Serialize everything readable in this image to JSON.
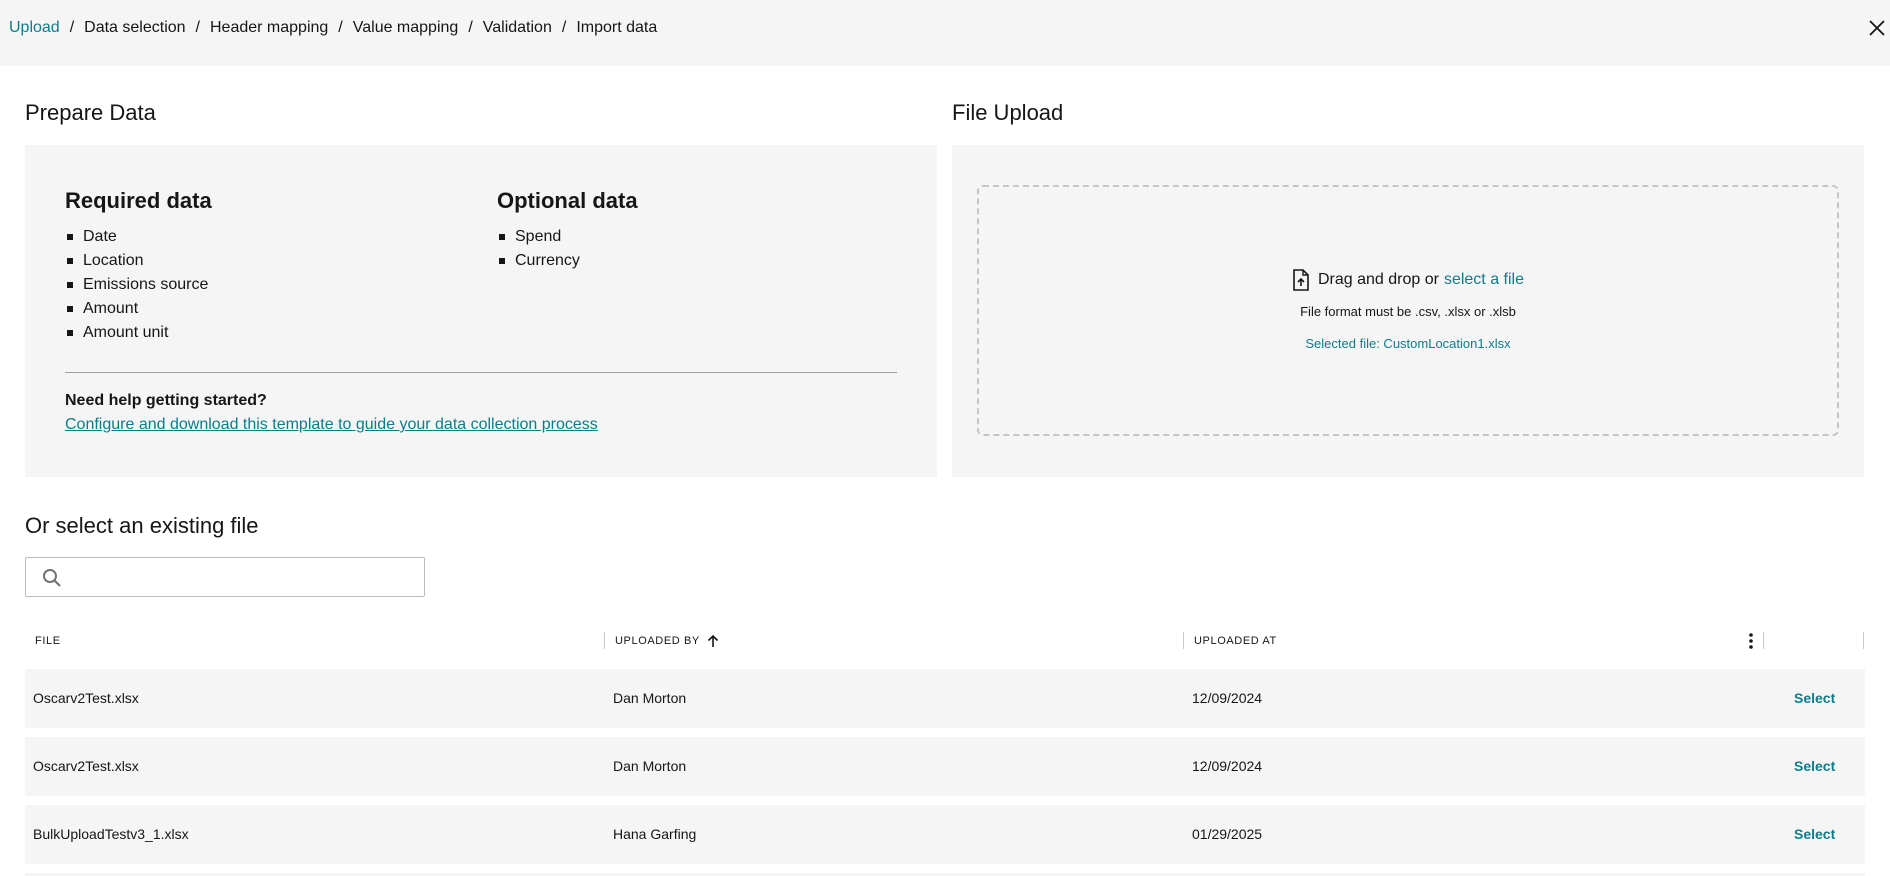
{
  "breadcrumb": {
    "items": [
      "Upload",
      "Data selection",
      "Header mapping",
      "Value mapping",
      "Validation",
      "Import data"
    ],
    "separator": "/"
  },
  "prepare": {
    "title": "Prepare Data",
    "required_title": "Required data",
    "required_items": [
      "Date",
      "Location",
      "Emissions source",
      "Amount",
      "Amount unit"
    ],
    "optional_title": "Optional data",
    "optional_items": [
      "Spend",
      "Currency"
    ],
    "help_title": "Need help getting started?",
    "help_link": "Configure and download this template to guide your data collection process"
  },
  "upload": {
    "title": "File Upload",
    "drag_text": "Drag and drop or",
    "select_link": "select a file",
    "format_text": "File format must be .csv, .xlsx or .xlsb",
    "selected_file": "Selected file: CustomLocation1.xlsx"
  },
  "existing": {
    "title": "Or select an existing file",
    "search_placeholder": ""
  },
  "table": {
    "headers": {
      "file": "FILE",
      "uploaded_by": "UPLOADED BY",
      "uploaded_at": "UPLOADED AT"
    },
    "select_label": "Select",
    "rows": [
      {
        "file": "Oscarv2Test.xlsx",
        "uploaded_by": "Dan Morton",
        "uploaded_at": "12/09/2024"
      },
      {
        "file": "Oscarv2Test.xlsx",
        "uploaded_by": "Dan Morton",
        "uploaded_at": "12/09/2024"
      },
      {
        "file": "BulkUploadTestv3_1.xlsx",
        "uploaded_by": "Hana Garfing",
        "uploaded_at": "01/29/2025"
      }
    ]
  },
  "colors": {
    "accent": "#0f7c8c",
    "panel": "#f4f5f4",
    "text": "#161616"
  },
  "icons": {
    "close": "close-icon",
    "file": "file-upload-icon",
    "search": "search-icon",
    "sort": "arrow-up-icon",
    "menu": "overflow-menu-icon"
  }
}
